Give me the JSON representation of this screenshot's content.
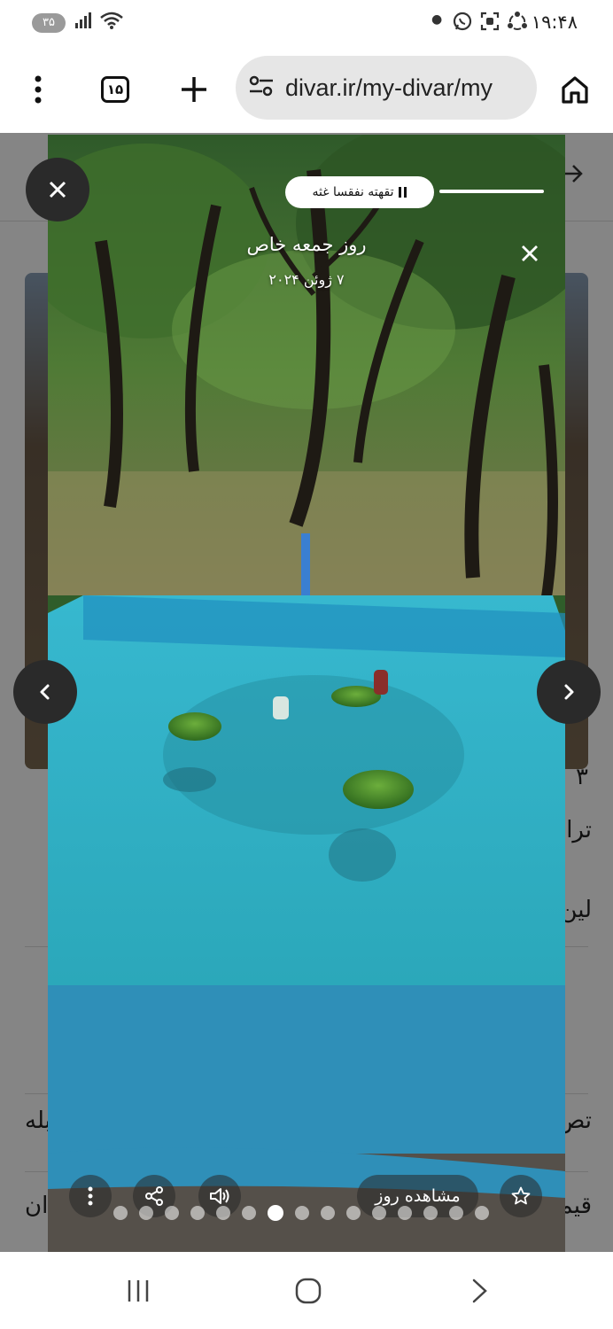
{
  "status_bar": {
    "time": "۱۹:۴۸",
    "battery": "۳۵"
  },
  "browser": {
    "url": "divar.ir/my-divar/my",
    "tab_count": "۱۵"
  },
  "background_page": {
    "ghost_texts": [
      "۳",
      "ترا",
      "لین",
      "تص",
      "بله",
      "قیم",
      "ان"
    ]
  },
  "story": {
    "pill_label": "تقهته نفقسا غثه",
    "title": "روز جمعه خاص",
    "date": "۷ ژوئن ۲۰۲۴",
    "view_button_label": "مشاهده روز",
    "progress_fraction": 1.0,
    "dot_count": 15,
    "active_dot_index": 6
  }
}
